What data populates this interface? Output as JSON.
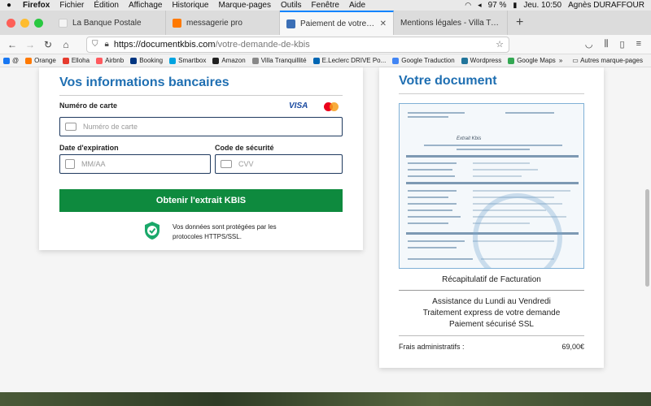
{
  "menubar": {
    "app": "Firefox",
    "items": [
      "Fichier",
      "Édition",
      "Affichage",
      "Historique",
      "Marque-pages",
      "Outils",
      "Fenêtre",
      "Aide"
    ],
    "battery": "97 %",
    "clock": "Jeu. 10:50",
    "user": "Agnès DURAFFOUR"
  },
  "tabs": [
    {
      "label": "La Banque Postale",
      "color": "#f4f4f4"
    },
    {
      "label": "messagerie pro",
      "color": "#ff7900"
    },
    {
      "label": "Paiement de votre demande d'e",
      "color": "#3b6fb6"
    },
    {
      "label": "Mentions légales - Villa Tranquillité",
      "color": "#cccccc"
    }
  ],
  "navbar": {
    "url_host": "https://documentkbis.com",
    "url_path": "/votre-demande-de-kbis"
  },
  "bookmarks": [
    {
      "label": "@",
      "color": "#1877f2"
    },
    {
      "label": "Orange",
      "color": "#ff7900"
    },
    {
      "label": "Elloha",
      "color": "#e63b2e"
    },
    {
      "label": "Airbnb",
      "color": "#ff5a5f"
    },
    {
      "label": "Booking",
      "color": "#003580"
    },
    {
      "label": "Smartbox",
      "color": "#00a3e0"
    },
    {
      "label": "Amazon",
      "color": "#222222"
    },
    {
      "label": "Villa Tranquillité",
      "color": "#888888"
    },
    {
      "label": "E.Leclerc DRIVE Po...",
      "color": "#0066b3"
    },
    {
      "label": "Google Traduction",
      "color": "#4285f4"
    },
    {
      "label": "Wordpress",
      "color": "#21759b"
    },
    {
      "label": "Google Maps",
      "color": "#34a853"
    }
  ],
  "bookmarks_other": "Autres marque-pages",
  "payment": {
    "title": "Vos informations bancaires",
    "card_number_label": "Numéro de carte",
    "card_brand_visa": "VISA",
    "card_number_placeholder": "Numéro de carte",
    "expiry_label": "Date d'expiration",
    "expiry_placeholder": "MM/AA",
    "cvv_label": "Code de sécurité",
    "cvv_placeholder": "CVV",
    "submit_label": "Obtenir l'extrait KBIS",
    "secure_text": "Vos données sont protégées par les protocoles HTTPS/SSL."
  },
  "document": {
    "title": "Votre document",
    "preview_heading": "Extrait Kbis",
    "recap_title": "Récapitulatif de Facturation",
    "info_lines": [
      "Assistance du Lundi au Vendredi",
      "Traitement express de votre demande",
      "Paiement sécurisé SSL"
    ],
    "fees_label": "Frais administratifs :",
    "fees_value": "69,00€"
  },
  "colors": {
    "accent": "#1f6fb2",
    "cta": "#0e8a3e"
  }
}
